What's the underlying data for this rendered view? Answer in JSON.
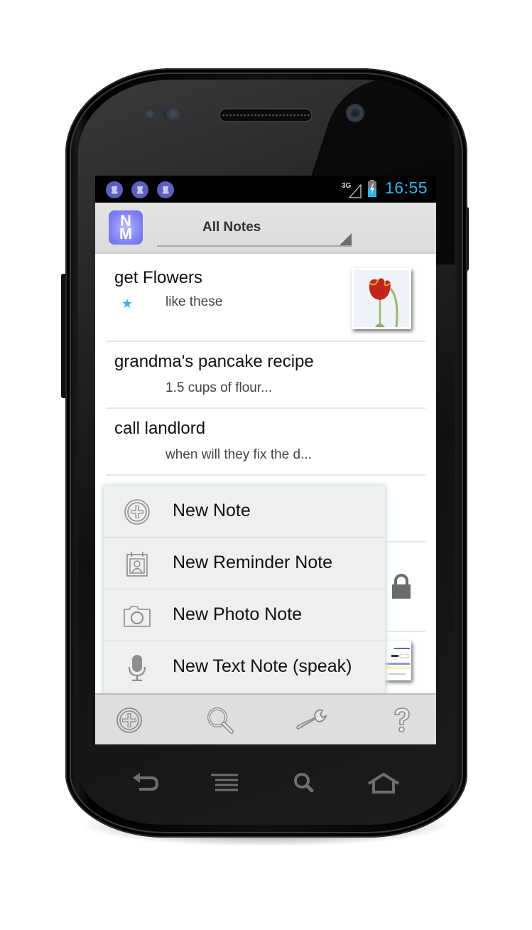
{
  "status_bar": {
    "notifications": [
      "note-reminder-icon",
      "note-reminder-icon",
      "note-reminder-icon"
    ],
    "network": "3G",
    "time": "16:55",
    "accent_color": "#33b5e5"
  },
  "action_bar": {
    "logo_text": [
      "N",
      "M"
    ],
    "spinner_label": "All Notes"
  },
  "notes": [
    {
      "title": "get Flowers",
      "preview": "like these",
      "starred": true,
      "attachment": "tulip-photo"
    },
    {
      "title": "grandma's pancake recipe",
      "preview": "1.5 cups of flour...",
      "starred": false
    },
    {
      "title": "call landlord",
      "preview": "when will they fix the d...",
      "starred": false
    },
    {
      "title": "",
      "preview": "",
      "starred": false
    },
    {
      "title": "",
      "preview": "",
      "locked": true
    },
    {
      "title": "",
      "preview": "",
      "attachment": "webpage-screenshot"
    }
  ],
  "popup_menu": {
    "items": [
      {
        "label": "New Note",
        "icon": "add-circle-icon"
      },
      {
        "label": "New Reminder Note",
        "icon": "calendar-contact-icon"
      },
      {
        "label": "New Photo Note",
        "icon": "camera-icon"
      },
      {
        "label": "New Text Note (speak)",
        "icon": "microphone-icon"
      }
    ]
  },
  "toolbar": {
    "buttons": [
      "add-icon",
      "search-icon",
      "settings-wrench-icon",
      "help-icon"
    ]
  },
  "hardware_keys": [
    "back-icon",
    "menu-icon",
    "search-icon",
    "home-icon"
  ]
}
